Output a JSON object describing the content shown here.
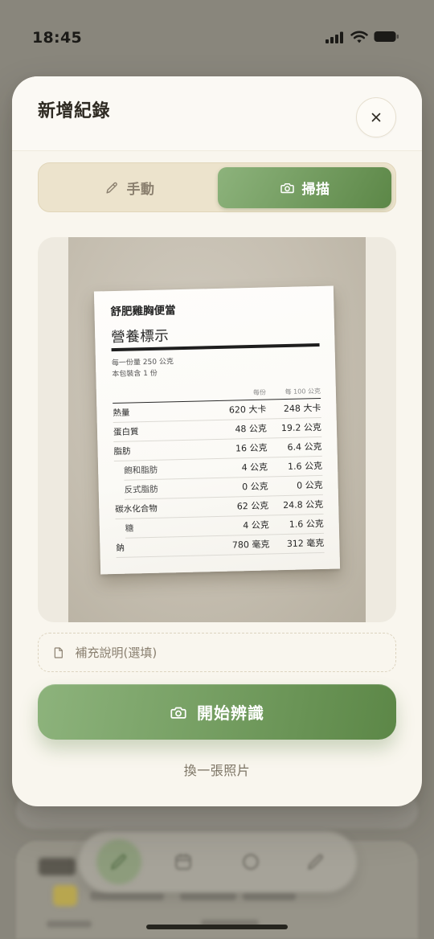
{
  "status_bar": {
    "time": "18:45",
    "icons": [
      "cellular-signal-icon",
      "wifi-icon",
      "battery-icon"
    ]
  },
  "modal": {
    "title": "新增紀錄",
    "close_icon": "close-icon",
    "tabs": [
      {
        "label": "手動",
        "icon": "pencil-icon",
        "active": false
      },
      {
        "label": "掃描",
        "icon": "camera-icon",
        "active": true
      }
    ],
    "scan_photo": {
      "label": {
        "product_name": "舒肥雞胸便當",
        "heading": "營養標示",
        "serving_size": "每一份量 250 公克",
        "servings_per_package": "本包裝含 1 份",
        "columns": [
          "每份",
          "每 100 公克"
        ],
        "rows": [
          {
            "name": "熱量",
            "per_serving": "620 大卡",
            "per_100g": "248 大卡",
            "indent": false
          },
          {
            "name": "蛋白質",
            "per_serving": "48 公克",
            "per_100g": "19.2 公克",
            "indent": false
          },
          {
            "name": "脂肪",
            "per_serving": "16 公克",
            "per_100g": "6.4 公克",
            "indent": false
          },
          {
            "name": "飽和脂肪",
            "per_serving": "4 公克",
            "per_100g": "1.6 公克",
            "indent": true
          },
          {
            "name": "反式脂肪",
            "per_serving": "0 公克",
            "per_100g": "0 公克",
            "indent": true
          },
          {
            "name": "碳水化合物",
            "per_serving": "62 公克",
            "per_100g": "24.8 公克",
            "indent": false
          },
          {
            "name": "糖",
            "per_serving": "4 公克",
            "per_100g": "1.6 公克",
            "indent": true
          },
          {
            "name": "鈉",
            "per_serving": "780 毫克",
            "per_100g": "312 毫克",
            "indent": false
          }
        ]
      }
    },
    "note_input": {
      "icon": "file-icon",
      "placeholder": "補充說明(選填)",
      "value": ""
    },
    "primary_button": {
      "icon": "camera-icon",
      "label": "開始辨識"
    },
    "secondary_link": {
      "label": "換一張照片"
    }
  },
  "background_app": {
    "nav_icons": [
      "pencil-icon",
      "calendar-icon",
      "circle-icon",
      "edit-icon"
    ]
  },
  "colors": {
    "overlay_background": "#89867c",
    "modal_background": "#f9f6ee",
    "segment_background": "#ece3cc",
    "accent_start": "#8db37c",
    "accent_end": "#5c8747",
    "text_primary": "#2e2a22",
    "text_muted": "#8a8070"
  }
}
